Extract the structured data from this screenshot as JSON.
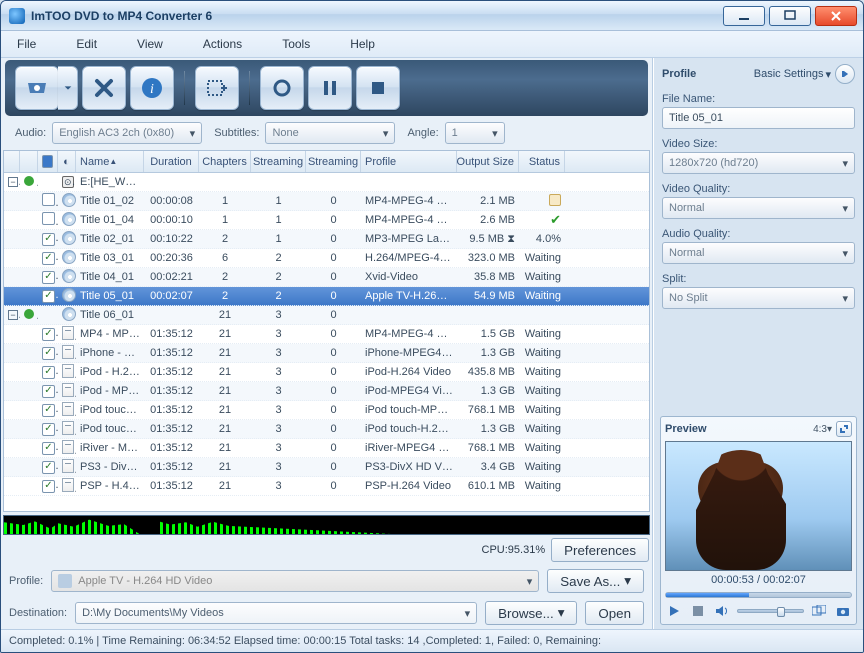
{
  "titlebar": {
    "title": "ImTOO DVD to MP4 Converter 6"
  },
  "menu": {
    "file": "File",
    "edit": "Edit",
    "view": "View",
    "actions": "Actions",
    "tools": "Tools",
    "help": "Help"
  },
  "opts": {
    "audio_lbl": "Audio:",
    "audio_val": "English AC3 2ch (0x80)",
    "subs_lbl": "Subtitles:",
    "subs_val": "None",
    "angle_lbl": "Angle:",
    "angle_val": "1"
  },
  "columns": {
    "name": "Name",
    "duration": "Duration",
    "chapters": "Chapters",
    "stream1": "Streaming",
    "stream2": "Streaming",
    "profile": "Profile",
    "size": "Output Size",
    "status": "Status"
  },
  "rows": [
    {
      "kind": "folder",
      "type": "dvd",
      "name": "E:[HE_W…",
      "dur": "",
      "chap": "",
      "s1": "",
      "s2": "",
      "prof": "",
      "siz": "",
      "stat": ""
    },
    {
      "kind": "item",
      "chk": false,
      "type": "cd",
      "name": "Title 01_02",
      "dur": "00:00:08",
      "chap": "1",
      "s1": "1",
      "s2": "0",
      "prof": "MP4-MPEG-4 Vi…",
      "siz": "2.1 MB",
      "stat": "done"
    },
    {
      "kind": "item",
      "chk": false,
      "type": "cd",
      "name": "Title 01_04",
      "dur": "00:00:10",
      "chap": "1",
      "s1": "1",
      "s2": "0",
      "prof": "MP4-MPEG-4 Vi…",
      "siz": "2.6 MB",
      "stat": "ok"
    },
    {
      "kind": "item",
      "chk": true,
      "type": "cd",
      "name": "Title 02_01",
      "dur": "00:10:22",
      "chap": "2",
      "s1": "1",
      "s2": "0",
      "prof": "MP3-MPEG Lay…",
      "siz": "9.5 MB",
      "stat": "4.0%"
    },
    {
      "kind": "item",
      "chk": true,
      "type": "cd",
      "name": "Title 03_01",
      "dur": "00:20:36",
      "chap": "6",
      "s1": "2",
      "s2": "0",
      "prof": "H.264/MPEG-4…",
      "siz": "323.0 MB",
      "stat": "Waiting"
    },
    {
      "kind": "item",
      "chk": true,
      "type": "cd",
      "name": "Title 04_01",
      "dur": "00:02:21",
      "chap": "2",
      "s1": "2",
      "s2": "0",
      "prof": "Xvid-Video",
      "siz": "35.8 MB",
      "stat": "Waiting"
    },
    {
      "kind": "item",
      "chk": true,
      "type": "cd",
      "name": "Title 05_01",
      "dur": "00:02:07",
      "chap": "2",
      "s1": "2",
      "s2": "0",
      "prof": "Apple TV-H.264…",
      "siz": "54.9 MB",
      "stat": "Waiting",
      "sel": true
    },
    {
      "kind": "folder",
      "type": "cd",
      "name": "Title 06_01",
      "dur": "",
      "chap": "21",
      "s1": "3",
      "s2": "0",
      "prof": "",
      "siz": "",
      "stat": ""
    },
    {
      "kind": "item",
      "indent": true,
      "chk": true,
      "type": "txt",
      "name": "MP4 - MP…",
      "dur": "01:35:12",
      "chap": "21",
      "s1": "3",
      "s2": "0",
      "prof": "MP4-MPEG-4 Vi…",
      "siz": "1.5 GB",
      "stat": "Waiting"
    },
    {
      "kind": "item",
      "indent": true,
      "chk": true,
      "type": "txt",
      "name": "iPhone - …",
      "dur": "01:35:12",
      "chap": "21",
      "s1": "3",
      "s2": "0",
      "prof": "iPhone-MPEG4 …",
      "siz": "1.3 GB",
      "stat": "Waiting"
    },
    {
      "kind": "item",
      "indent": true,
      "chk": true,
      "type": "txt",
      "name": "iPod - H.2…",
      "dur": "01:35:12",
      "chap": "21",
      "s1": "3",
      "s2": "0",
      "prof": "iPod-H.264 Video",
      "siz": "435.8 MB",
      "stat": "Waiting"
    },
    {
      "kind": "item",
      "indent": true,
      "chk": true,
      "type": "txt",
      "name": "iPod - MP…",
      "dur": "01:35:12",
      "chap": "21",
      "s1": "3",
      "s2": "0",
      "prof": "iPod-MPEG4 Vid…",
      "siz": "1.3 GB",
      "stat": "Waiting"
    },
    {
      "kind": "item",
      "indent": true,
      "chk": true,
      "type": "txt",
      "name": "iPod touc…",
      "dur": "01:35:12",
      "chap": "21",
      "s1": "3",
      "s2": "0",
      "prof": "iPod touch-MPE…",
      "siz": "768.1 MB",
      "stat": "Waiting"
    },
    {
      "kind": "item",
      "indent": true,
      "chk": true,
      "type": "txt",
      "name": "iPod touc…",
      "dur": "01:35:12",
      "chap": "21",
      "s1": "3",
      "s2": "0",
      "prof": "iPod touch-H.2…",
      "siz": "1.3 GB",
      "stat": "Waiting"
    },
    {
      "kind": "item",
      "indent": true,
      "chk": true,
      "type": "txt",
      "name": "iRiver - M…",
      "dur": "01:35:12",
      "chap": "21",
      "s1": "3",
      "s2": "0",
      "prof": "iRiver-MPEG4 Vi…",
      "siz": "768.1 MB",
      "stat": "Waiting"
    },
    {
      "kind": "item",
      "indent": true,
      "chk": true,
      "type": "txt",
      "name": "PS3 - Div…",
      "dur": "01:35:12",
      "chap": "21",
      "s1": "3",
      "s2": "0",
      "prof": "PS3-DivX HD Vi…",
      "siz": "3.4 GB",
      "stat": "Waiting"
    },
    {
      "kind": "item",
      "indent": true,
      "chk": true,
      "type": "txt",
      "name": "PSP - H.4…",
      "dur": "01:35:12",
      "chap": "21",
      "s1": "3",
      "s2": "0",
      "prof": "PSP-H.264 Video",
      "siz": "610.1 MB",
      "stat": "Waiting"
    }
  ],
  "cpu": {
    "label": "CPU:95.31%",
    "prefs": "Preferences"
  },
  "profileRow": {
    "lbl": "Profile:",
    "val": "Apple TV - H.264 HD Video",
    "save": "Save As..."
  },
  "destRow": {
    "lbl": "Destination:",
    "val": "D:\\My Documents\\My Videos",
    "browse": "Browse...",
    "open": "Open"
  },
  "footer": {
    "text": "Completed: 0.1% | Time Remaining: 06:34:52 Elapsed time: 00:00:15 Total tasks: 14 ,Completed: 1, Failed: 0, Remaining:"
  },
  "panel": {
    "title": "Profile",
    "adv": "Basic Settings",
    "filename_lbl": "File Name:",
    "filename_val": "Title 05_01",
    "vsize_lbl": "Video Size:",
    "vsize_val": "1280x720 (hd720)",
    "vqual_lbl": "Video Quality:",
    "vqual_val": "Normal",
    "aqual_lbl": "Audio Quality:",
    "aqual_val": "Normal",
    "split_lbl": "Split:",
    "split_val": "No Split"
  },
  "preview": {
    "title": "Preview",
    "aspect": "4:3",
    "time": "00:00:53 / 00:02:07"
  }
}
